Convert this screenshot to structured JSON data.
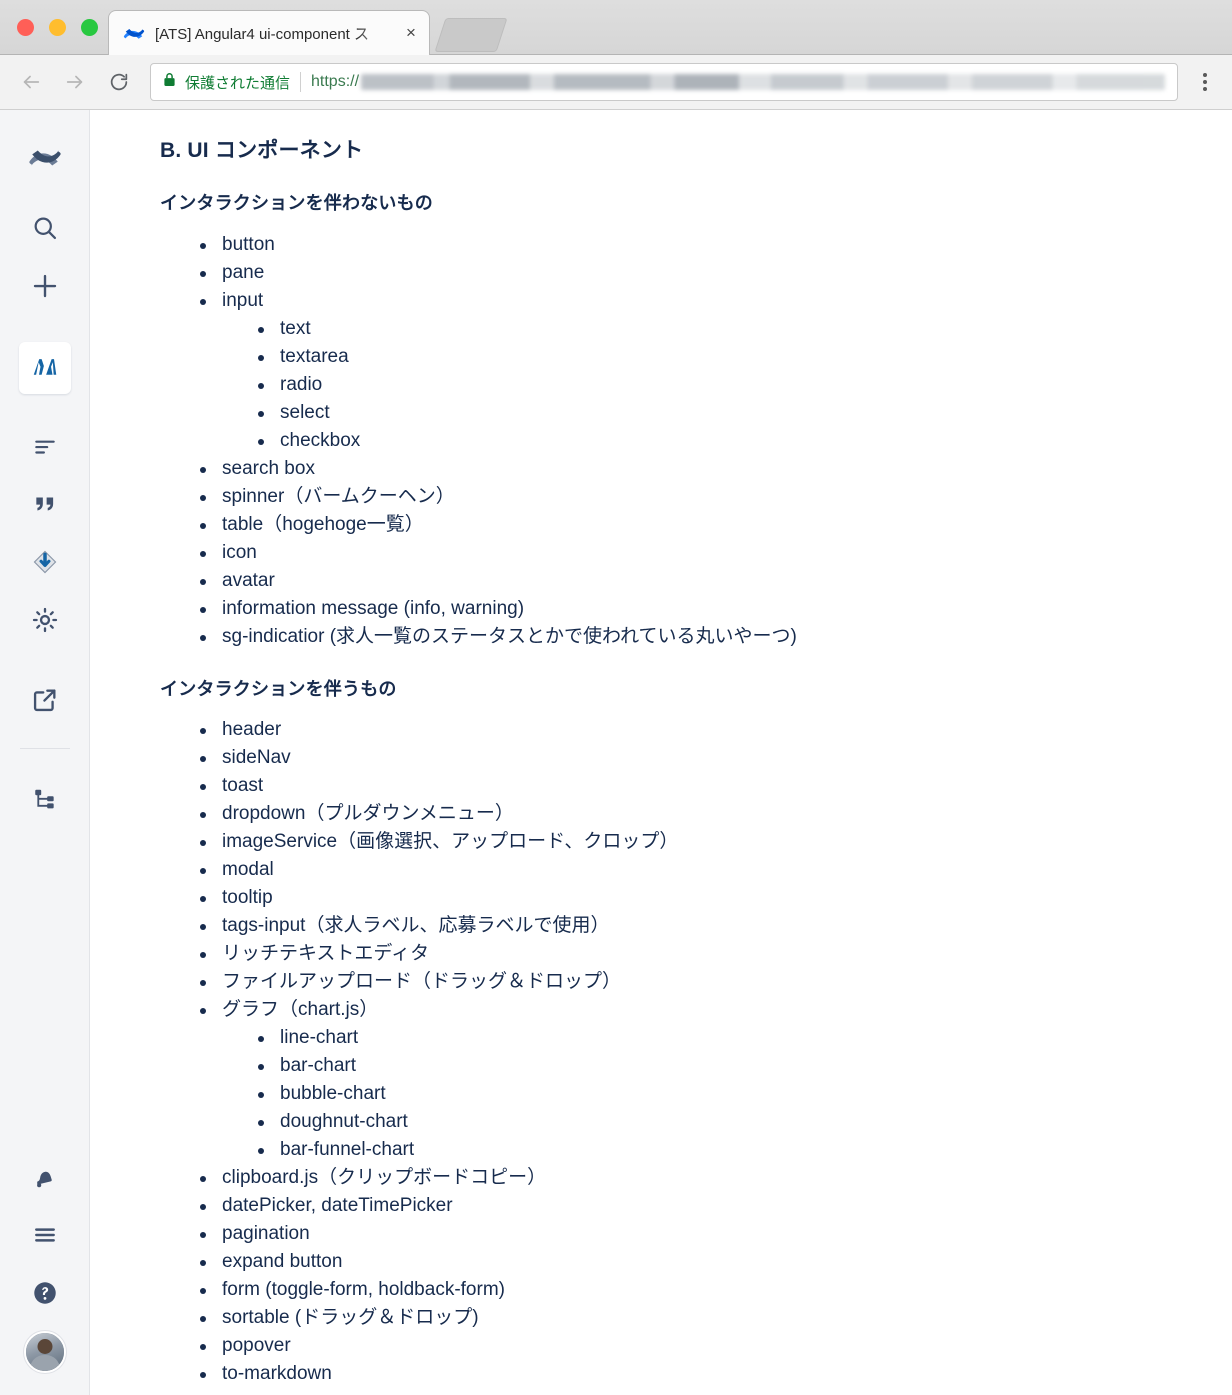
{
  "browser": {
    "tab": {
      "title": "[ATS] Angular4 ui-component ス",
      "favicon": "confluence-logo-icon",
      "close_label": "×"
    },
    "toolbar": {
      "back_icon": "back-arrow-icon",
      "forward_icon": "forward-arrow-icon",
      "reload_icon": "reload-icon",
      "secure_label": "保護された通信",
      "scheme": "https://",
      "url_redacted": "",
      "menu_icon": "kebab-menu-icon"
    },
    "window_controls": {
      "close": "close",
      "minimize": "minimize",
      "zoom": "zoom"
    }
  },
  "sidebar": {
    "items": [
      {
        "name": "confluence-logo-icon",
        "label": "Confluence",
        "active": false
      },
      {
        "name": "search-icon",
        "label": "検索",
        "active": false
      },
      {
        "name": "plus-icon",
        "label": "作成",
        "active": false
      },
      {
        "name": "spaces-icon",
        "label": "スペース",
        "active": true
      },
      {
        "name": "align-left-icon",
        "label": "フィード",
        "active": false
      },
      {
        "name": "quote-icon",
        "label": "ブログ",
        "active": false
      },
      {
        "name": "ribbon-icon",
        "label": "バッジ",
        "active": false
      },
      {
        "name": "gear-icon",
        "label": "設定",
        "active": false
      },
      {
        "name": "external-link-icon",
        "label": "外部リンク",
        "active": false
      },
      {
        "name": "page-tree-icon",
        "label": "ページツリー",
        "active": false
      }
    ],
    "bottom_items": [
      {
        "name": "notification-bell-icon",
        "label": "通知"
      },
      {
        "name": "hamburger-menu-icon",
        "label": "メニュー"
      },
      {
        "name": "help-icon",
        "label": "ヘルプ"
      },
      {
        "name": "avatar",
        "label": "プロフィール"
      }
    ]
  },
  "content": {
    "heading": "B. UI コンポーネント",
    "sections": [
      {
        "subheading": "インタラクションを伴わないもの",
        "items": [
          {
            "text": "button"
          },
          {
            "text": "pane"
          },
          {
            "text": "input",
            "children": [
              {
                "text": "text"
              },
              {
                "text": "textarea"
              },
              {
                "text": "radio"
              },
              {
                "text": "select"
              },
              {
                "text": "checkbox"
              }
            ]
          },
          {
            "text": "search box"
          },
          {
            "text": "spinner（バームクーヘン）"
          },
          {
            "text": "table（hogehoge一覧）"
          },
          {
            "text": "icon"
          },
          {
            "text": "avatar"
          },
          {
            "text": "information message (info, warning)"
          },
          {
            "text": "sg-indicatior (求人一覧のステータスとかで使われている丸いやーつ)"
          }
        ]
      },
      {
        "subheading": "インタラクションを伴うもの",
        "items": [
          {
            "text": "header"
          },
          {
            "text": "sideNav"
          },
          {
            "text": "toast"
          },
          {
            "text": "dropdown（プルダウンメニュー）"
          },
          {
            "text": "imageService（画像選択、アップロード、クロップ）"
          },
          {
            "text": "modal"
          },
          {
            "text": "tooltip"
          },
          {
            "text": "tags-input（求人ラベル、応募ラベルで使用）"
          },
          {
            "text": "リッチテキストエディタ"
          },
          {
            "text": "ファイルアップロード（ドラッグ＆ドロップ）"
          },
          {
            "text": "グラフ（chart.js）",
            "children": [
              {
                "text": "line-chart"
              },
              {
                "text": "bar-chart"
              },
              {
                "text": "bubble-chart"
              },
              {
                "text": "doughnut-chart"
              },
              {
                "text": "bar-funnel-chart"
              }
            ]
          },
          {
            "text": "clipboard.js（クリップボードコピー）"
          },
          {
            "text": "datePicker, dateTimePicker"
          },
          {
            "text": "pagination"
          },
          {
            "text": "expand button"
          },
          {
            "text": "form (toggle-form, holdback-form)"
          },
          {
            "text": "sortable (ドラッグ＆ドロップ)"
          },
          {
            "text": "popover"
          },
          {
            "text": "to-markdown"
          }
        ]
      }
    ]
  },
  "colors": {
    "text": "#172b4d",
    "sidebar_bg": "#f4f5f7",
    "accent_blue": "#1565a5",
    "secure_green": "#0f7c33"
  }
}
